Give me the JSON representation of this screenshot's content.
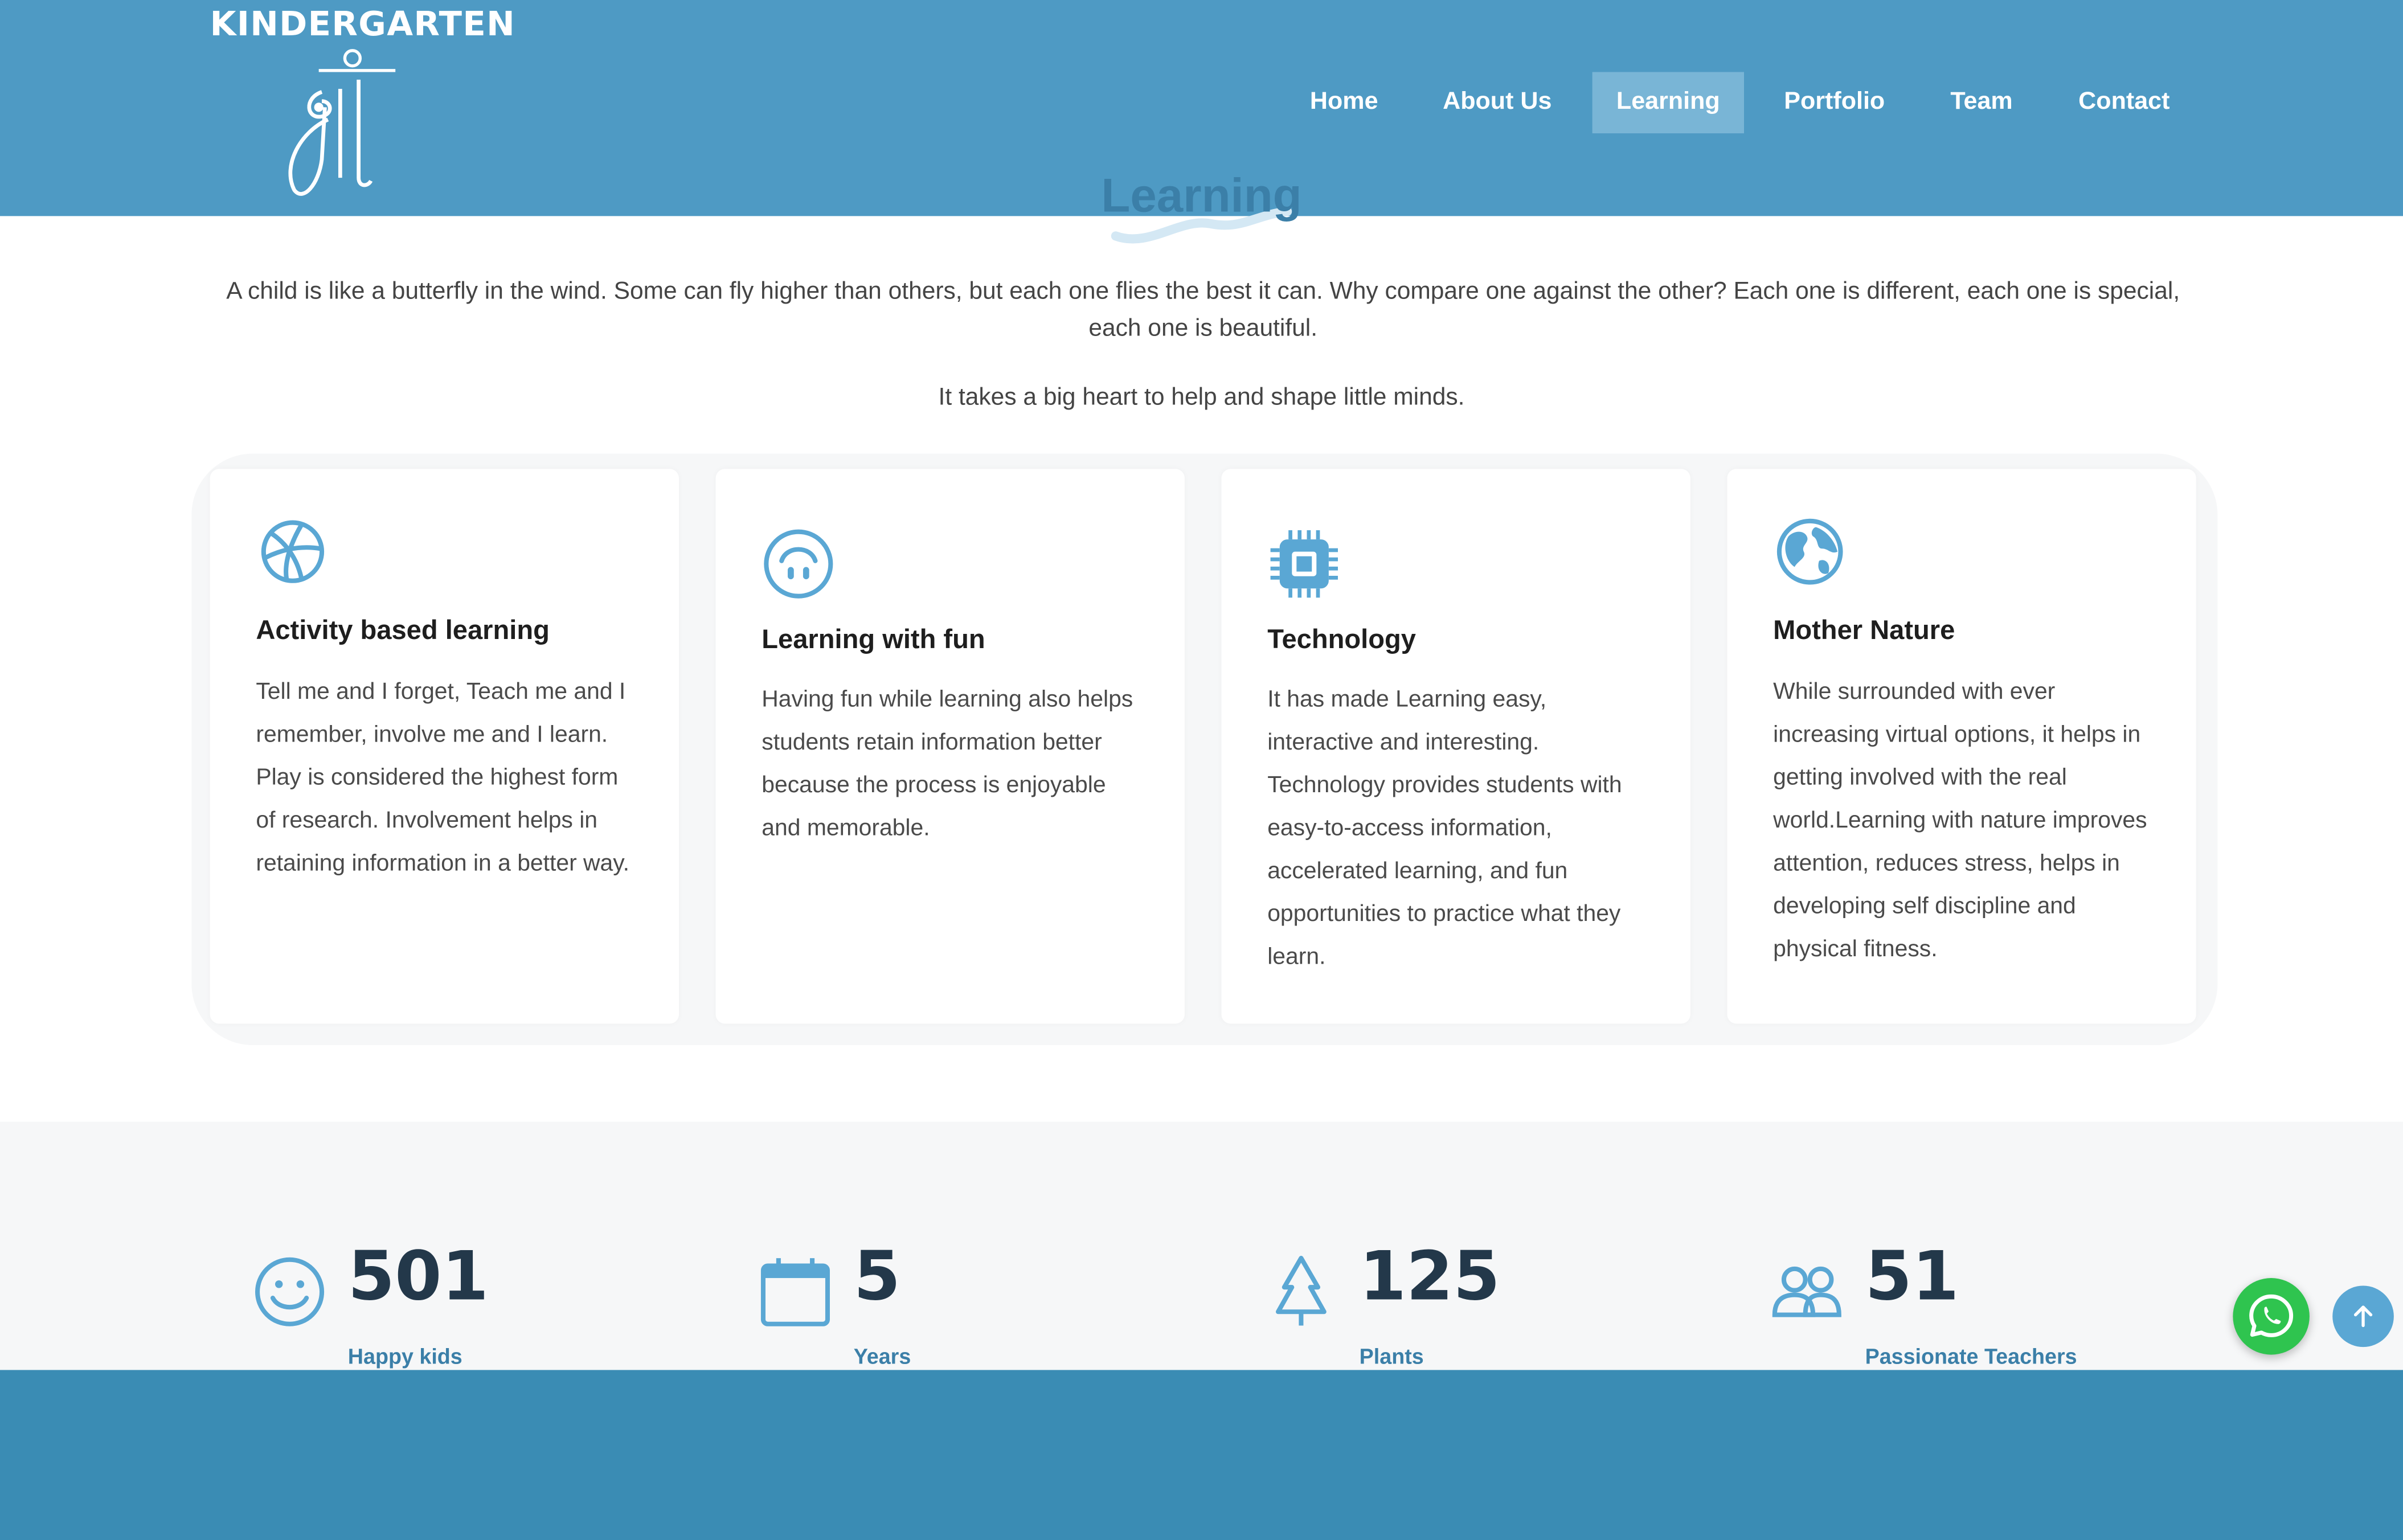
{
  "brand": {
    "name": "KINDERGARTEN"
  },
  "nav": {
    "items": [
      {
        "label": "Home"
      },
      {
        "label": "About Us"
      },
      {
        "label": "Learning"
      },
      {
        "label": "Portfolio"
      },
      {
        "label": "Team"
      },
      {
        "label": "Contact"
      }
    ],
    "active": "Learning"
  },
  "section": {
    "title": "Learning"
  },
  "intro": {
    "paragraph1": "A child is like a butterfly in the wind. Some can fly higher than others, but each one flies the best it can. Why compare one against the other? Each one is different, each one is special, each one is beautiful.",
    "paragraph2": "It takes a big heart to help and shape little minds."
  },
  "cards": [
    {
      "icon": "basketball-icon",
      "title": "Activity based learning",
      "text": "Tell me and I forget, Teach me and I remember, involve me and I learn. Play is considered the highest form of research. Involvement helps in retaining information in a better way."
    },
    {
      "icon": "upside-down-smile-icon",
      "title": "Learning with fun",
      "text": "Having fun while learning also helps students retain information better because the process is enjoyable and memorable."
    },
    {
      "icon": "cpu-chip-icon",
      "title": "Technology",
      "text": "It has made Learning easy, interactive and interesting. Technology provides students with easy-to-access information, accelerated learning, and fun opportunities to practice what they learn."
    },
    {
      "icon": "globe-icon",
      "title": "Mother Nature",
      "text": "While surrounded with ever increasing virtual options, it helps in getting involved with the real world.Learning with nature improves attention, reduces stress, helps in developing self discipline and physical fitness."
    }
  ],
  "stats": [
    {
      "icon": "smiley-icon",
      "value": "501",
      "label": "Happy kids"
    },
    {
      "icon": "calendar-icon",
      "value": "5",
      "label": "Years"
    },
    {
      "icon": "tree-icon",
      "value": "125",
      "label": "Plants"
    },
    {
      "icon": "people-icon",
      "value": "51",
      "label": "Passionate Teachers"
    }
  ],
  "colors": {
    "header": "#4e9ac4",
    "accent": "#3b7fa8",
    "footer": "#3a8cb4",
    "whatsapp": "#2fc44f"
  },
  "floating": {
    "whatsapp_icon": "whatsapp-icon",
    "scroll_top_icon": "arrow-up-icon"
  }
}
